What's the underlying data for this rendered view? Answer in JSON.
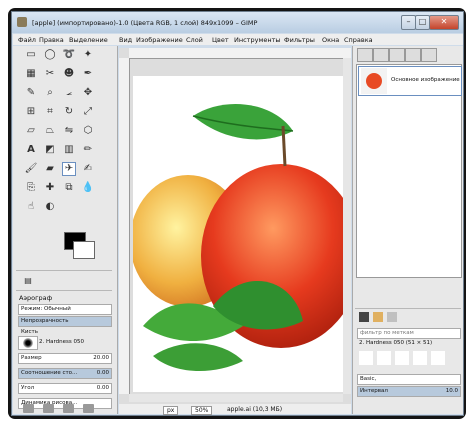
{
  "window": {
    "title": "[apple] (импортировано)-1.0 (Цвета RGB, 1 слой) 849x1099 – GIMP"
  },
  "menubar": {
    "items": [
      "Файл",
      "Правка",
      "Выделение",
      "Вид",
      "Изображение",
      "Слой",
      "Цвет",
      "Инструменты",
      "Фильтры",
      "Окна",
      "Справка"
    ]
  },
  "tool_options": {
    "title": "Аэрограф",
    "mode_label": "Режим:",
    "mode_value": "Обычный",
    "opacity_label": "Непрозрачность",
    "brush_label": "Кисть",
    "brush_value": "2. Hardness 050",
    "size_label": "Размер",
    "size_value": "20.00",
    "ratio_label": "Соотношение сто...",
    "ratio_value": "0.00",
    "angle_label": "Угол",
    "angle_value": "0.00",
    "dynamics_value": "Динамика рисова..."
  },
  "statusbar": {
    "unit": "px",
    "zoom": "50%",
    "file": "apple.ai (10,3 МБ)"
  },
  "layers": {
    "items": [
      {
        "name": "Основное изображение"
      }
    ]
  },
  "brushes": {
    "filter_placeholder": "фильтр по меткам",
    "current": "2. Hardness 050 (51 × 51)",
    "tag": "Basic,",
    "spacing_label": "Интервал",
    "spacing_value": "10.0"
  },
  "colors": {
    "accent": "#6a8fc0",
    "close": "#c4442b"
  }
}
